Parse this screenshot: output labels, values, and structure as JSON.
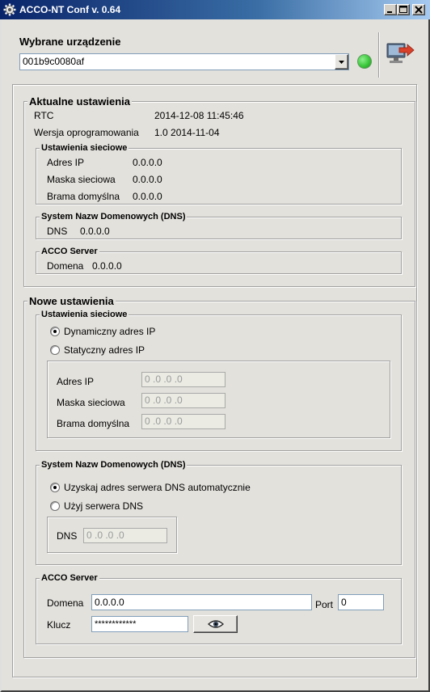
{
  "window": {
    "title": "ACCO-NT Conf v. 0.64"
  },
  "device": {
    "label": "Wybrane urządzenie",
    "value": "001b9c0080af",
    "status_color": "#3cc83c"
  },
  "current": {
    "title": "Aktualne ustawienia",
    "rtc_label": "RTC",
    "rtc_value": "2014-12-08 11:45:46",
    "fw_label": "Wersja oprogramowania",
    "fw_value": "1.0 2014-11-04",
    "network": {
      "title": "Ustawienia sieciowe",
      "ip_label": "Adres IP",
      "ip_value": "0.0.0.0",
      "mask_label": "Maska sieciowa",
      "mask_value": "0.0.0.0",
      "gw_label": "Brama domyślna",
      "gw_value": "0.0.0.0"
    },
    "dns": {
      "title": "System Nazw Domenowych (DNS)",
      "label": "DNS",
      "value": "0.0.0.0"
    },
    "server": {
      "title": "ACCO Server",
      "label": "Domena",
      "value": "0.0.0.0"
    }
  },
  "new": {
    "title": "Nowe ustawienia",
    "network": {
      "title": "Ustawienia sieciowe",
      "dynamic_label": "Dynamiczny adres IP",
      "static_label": "Statyczny adres IP",
      "ip_label": "Adres IP",
      "ip_value": "0 .0 .0 .0",
      "mask_label": "Maska sieciowa",
      "mask_value": "0 .0 .0 .0",
      "gw_label": "Brama domyślna",
      "gw_value": "0 .0 .0 .0"
    },
    "dns": {
      "title": "System Nazw Domenowych (DNS)",
      "auto_label": "Uzyskaj adres serwera DNS automatycznie",
      "manual_label": "Użyj serwera DNS",
      "label": "DNS",
      "value": "0 .0 .0 .0"
    },
    "server": {
      "title": "ACCO Server",
      "domain_label": "Domena",
      "domain_value": "0.0.0.0",
      "port_label": "Port",
      "port_value": "0",
      "key_label": "Klucz",
      "key_value": "************"
    }
  }
}
